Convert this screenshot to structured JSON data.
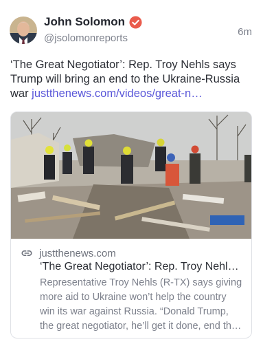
{
  "post": {
    "author": {
      "display_name": "John Solomon",
      "handle": "@jsolomonreports",
      "verified": true,
      "verified_color": "#ea5b4c"
    },
    "timestamp": "6m",
    "text": "‘The Great Negotiator’: Rep. Troy Nehls says Trump will bring an end to the Ukraine-Russia war ",
    "link_text": "justthenews.com/videos/great-n…",
    "link_color": "#5a57d9"
  },
  "card": {
    "domain": "justthenews.com",
    "title": "‘The Great Negotiator’: Rep. Troy Nehl…",
    "description_lines": [
      "Representative Troy Nehls (R-TX) says giving",
      "more aid to Ukraine won’t help the country",
      "win its war against Russia. “Donald Trump,",
      "the great negotiator, he’ll get it done, end th…"
    ]
  },
  "icons": {
    "verified": "verified-badge-icon",
    "link": "link-chain-icon"
  }
}
